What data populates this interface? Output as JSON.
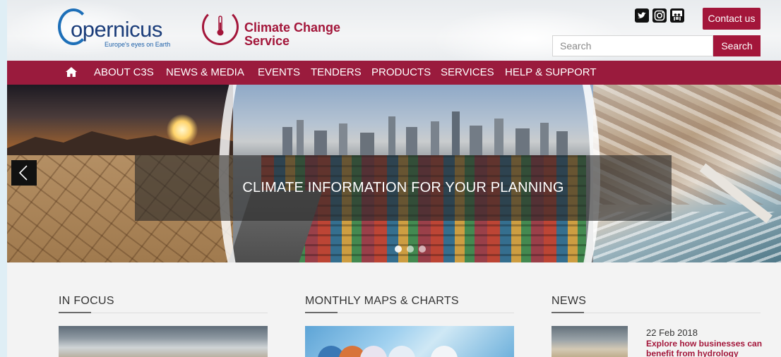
{
  "header": {
    "copernicus_logo": {
      "word": "opernicus",
      "tagline": "Europe's eyes on Earth"
    },
    "c3s_logo": {
      "line1": "Climate Change",
      "line2": "Service"
    },
    "social_icons": [
      "twitter-icon",
      "instagram-icon",
      "slideshare-icon"
    ],
    "contact_label": "Contact us",
    "search": {
      "placeholder": "Search",
      "button_label": "Search"
    }
  },
  "nav": {
    "home_icon": "home-icon",
    "items": [
      {
        "label": "ABOUT C3S"
      },
      {
        "label": "NEWS & MEDIA"
      },
      {
        "label": "EVENTS"
      },
      {
        "label": "TENDERS"
      },
      {
        "label": "PRODUCTS"
      },
      {
        "label": "SERVICES"
      },
      {
        "label": "HELP & SUPPORT"
      }
    ]
  },
  "hero": {
    "caption": "CLIMATE INFORMATION FOR YOUR PLANNING",
    "prev_icon": "chevron-left-icon",
    "slide_count": 3,
    "active_slide": 1
  },
  "sections": {
    "focus_title": "IN FOCUS",
    "maps_title": "MONTHLY MAPS & CHARTS",
    "news_title": "NEWS"
  },
  "news": {
    "date": "22 Feb 2018",
    "headline": "Explore how businesses can benefit from hydrology"
  },
  "colors": {
    "brand": "#a3163a",
    "nav": "#9a1b3d",
    "copernicus_blue": "#1b3d7a"
  }
}
